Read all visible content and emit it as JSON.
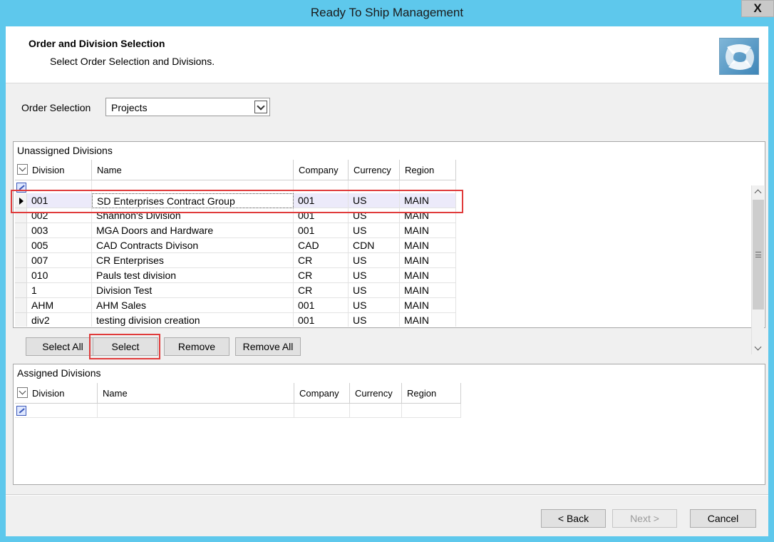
{
  "window": {
    "title": "Ready To Ship Management",
    "close_label": "X"
  },
  "header": {
    "title": "Order and Division Selection",
    "subtitle": "Select Order Selection and Divisions."
  },
  "order_selection": {
    "label": "Order Selection",
    "value": "Projects"
  },
  "unassigned": {
    "label": "Unassigned Divisions",
    "columns": [
      "Division",
      "Name",
      "Company",
      "Currency",
      "Region"
    ],
    "rows": [
      [
        "001",
        "SD Enterprises Contract Group",
        "001",
        "US",
        "MAIN"
      ],
      [
        "002",
        "Shannon's Division",
        "001",
        "US",
        "MAIN"
      ],
      [
        "003",
        "MGA Doors and Hardware",
        "001",
        "US",
        "MAIN"
      ],
      [
        "005",
        "CAD Contracts Divison",
        "CAD",
        "CDN",
        "MAIN"
      ],
      [
        "007",
        "CR Enterprises",
        "CR",
        "US",
        "MAIN"
      ],
      [
        "010",
        "Pauls test division",
        "CR",
        "US",
        "MAIN"
      ],
      [
        "1",
        "Division Test",
        "CR",
        "US",
        "MAIN"
      ],
      [
        "AHM",
        "AHM Sales",
        "001",
        "US",
        "MAIN"
      ],
      [
        "div2",
        "testing division creation",
        "001",
        "US",
        "MAIN"
      ]
    ]
  },
  "actions": {
    "select_all": "Select All",
    "select": "Select",
    "remove": "Remove",
    "remove_all": "Remove All"
  },
  "assigned": {
    "label": "Assigned Divisions",
    "columns": [
      "Division",
      "Name",
      "Company",
      "Currency",
      "Region"
    ]
  },
  "footer": {
    "back": "< Back",
    "next": "Next >",
    "cancel": "Cancel"
  }
}
